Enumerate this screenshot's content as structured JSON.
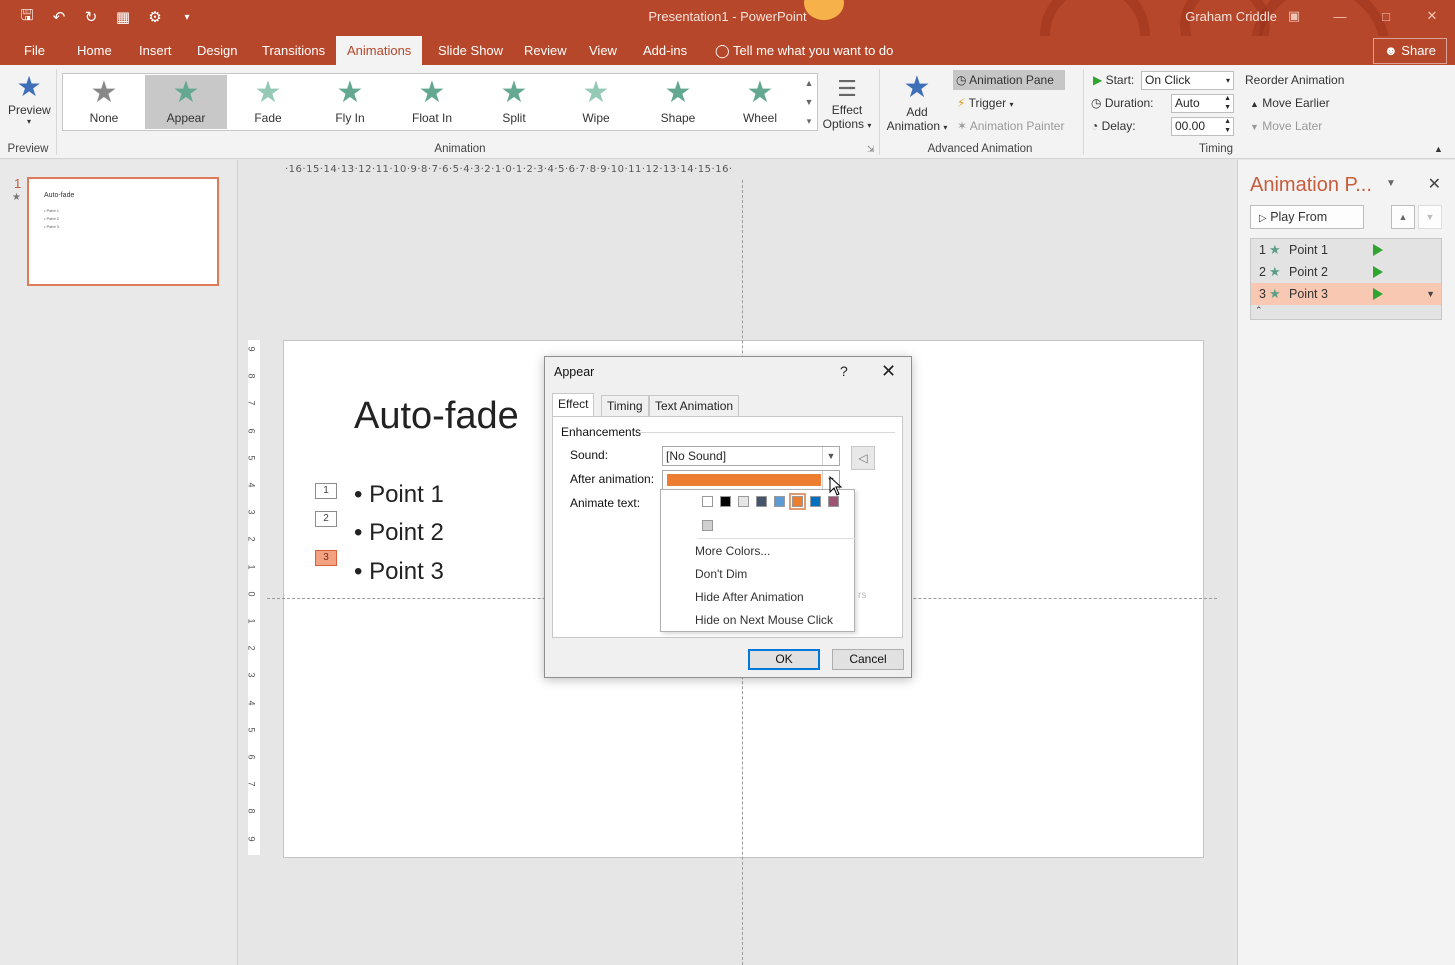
{
  "titlebar": {
    "title": "Presentation1 - PowerPoint",
    "user": "Graham Criddle",
    "qat_icons": [
      "save-icon",
      "undo-icon",
      "redo-icon",
      "start-from-beginning-icon",
      "customize-icon"
    ]
  },
  "tabs": [
    "File",
    "Home",
    "Insert",
    "Design",
    "Transitions",
    "Animations",
    "Slide Show",
    "Review",
    "View",
    "Add-ins"
  ],
  "active_tab": "Animations",
  "tell_me": "Tell me what you want to do",
  "share": "Share",
  "ribbon": {
    "preview_label": "Preview",
    "preview_group": "Preview",
    "gallery": [
      "None",
      "Appear",
      "Fade",
      "Fly In",
      "Float In",
      "Split",
      "Wipe",
      "Shape",
      "Wheel"
    ],
    "selected_effect": "Appear",
    "effect_options_line1": "Effect",
    "effect_options_line2": "Options",
    "animation_group": "Animation",
    "add_animation_line1": "Add",
    "add_animation_line2": "Animation",
    "animation_pane_btn": "Animation Pane",
    "trigger_btn": "Trigger",
    "animation_painter_btn": "Animation Painter",
    "advanced_group": "Advanced Animation",
    "start_label": "Start:",
    "start_value": "On Click",
    "duration_label": "Duration:",
    "duration_value": "Auto",
    "delay_label": "Delay:",
    "delay_value": "00.00",
    "reorder_label": "Reorder Animation",
    "move_earlier": "Move Earlier",
    "move_later": "Move Later",
    "timing_group": "Timing"
  },
  "thumbnails": {
    "number": "1",
    "title": "Auto-fade",
    "points": [
      "Point 1",
      "Point 2",
      "Point 3"
    ]
  },
  "ruler": {
    "horizontal": "·16·15·14·13·12·11·10·9·8·7·6·5·4·3·2·1·0·1·2·3·4·5·6·7·8·9·10·11·12·13·14·15·16·",
    "vertical": [
      "9",
      "8",
      "7",
      "6",
      "5",
      "4",
      "3",
      "2",
      "1",
      "0",
      "1",
      "2",
      "3",
      "4",
      "5",
      "6",
      "7",
      "8",
      "9"
    ]
  },
  "slide": {
    "title": "Auto-fade",
    "bullets": [
      "• Point 1",
      "• Point 2",
      "• Point 3"
    ],
    "tags": [
      "1",
      "2",
      "3"
    ]
  },
  "animation_pane": {
    "title": "Animation P...",
    "play_from": "Play From",
    "items": [
      {
        "num": "1",
        "label": "Point 1"
      },
      {
        "num": "2",
        "label": "Point 2"
      },
      {
        "num": "3",
        "label": "Point 3"
      }
    ],
    "selected_index": 2
  },
  "dialog": {
    "title": "Appear",
    "help": "?",
    "tabs": [
      "Effect",
      "Timing",
      "Text Animation"
    ],
    "active_tab": "Effect",
    "section": "Enhancements",
    "sound_label": "Sound:",
    "sound_value": "[No Sound]",
    "after_label": "After animation:",
    "animate_text_label": "Animate text:",
    "ok": "OK",
    "cancel": "Cancel"
  },
  "dropdown": {
    "colors": [
      "#ffffff",
      "#000000",
      "#e7e6e6",
      "#44546a",
      "#5b9bd5",
      "#ed7d31",
      "#0070c0",
      "#a05475"
    ],
    "selected_color": "#ed7d31",
    "recent_color": "#d0d0d0",
    "items": [
      "More Colors...",
      "Don't Dim",
      "Hide After Animation",
      "Hide on Next Mouse Click"
    ]
  },
  "colors": {
    "accent": "#b7472a",
    "highlight": "#f8c8b2",
    "star_green": "#64a891"
  }
}
